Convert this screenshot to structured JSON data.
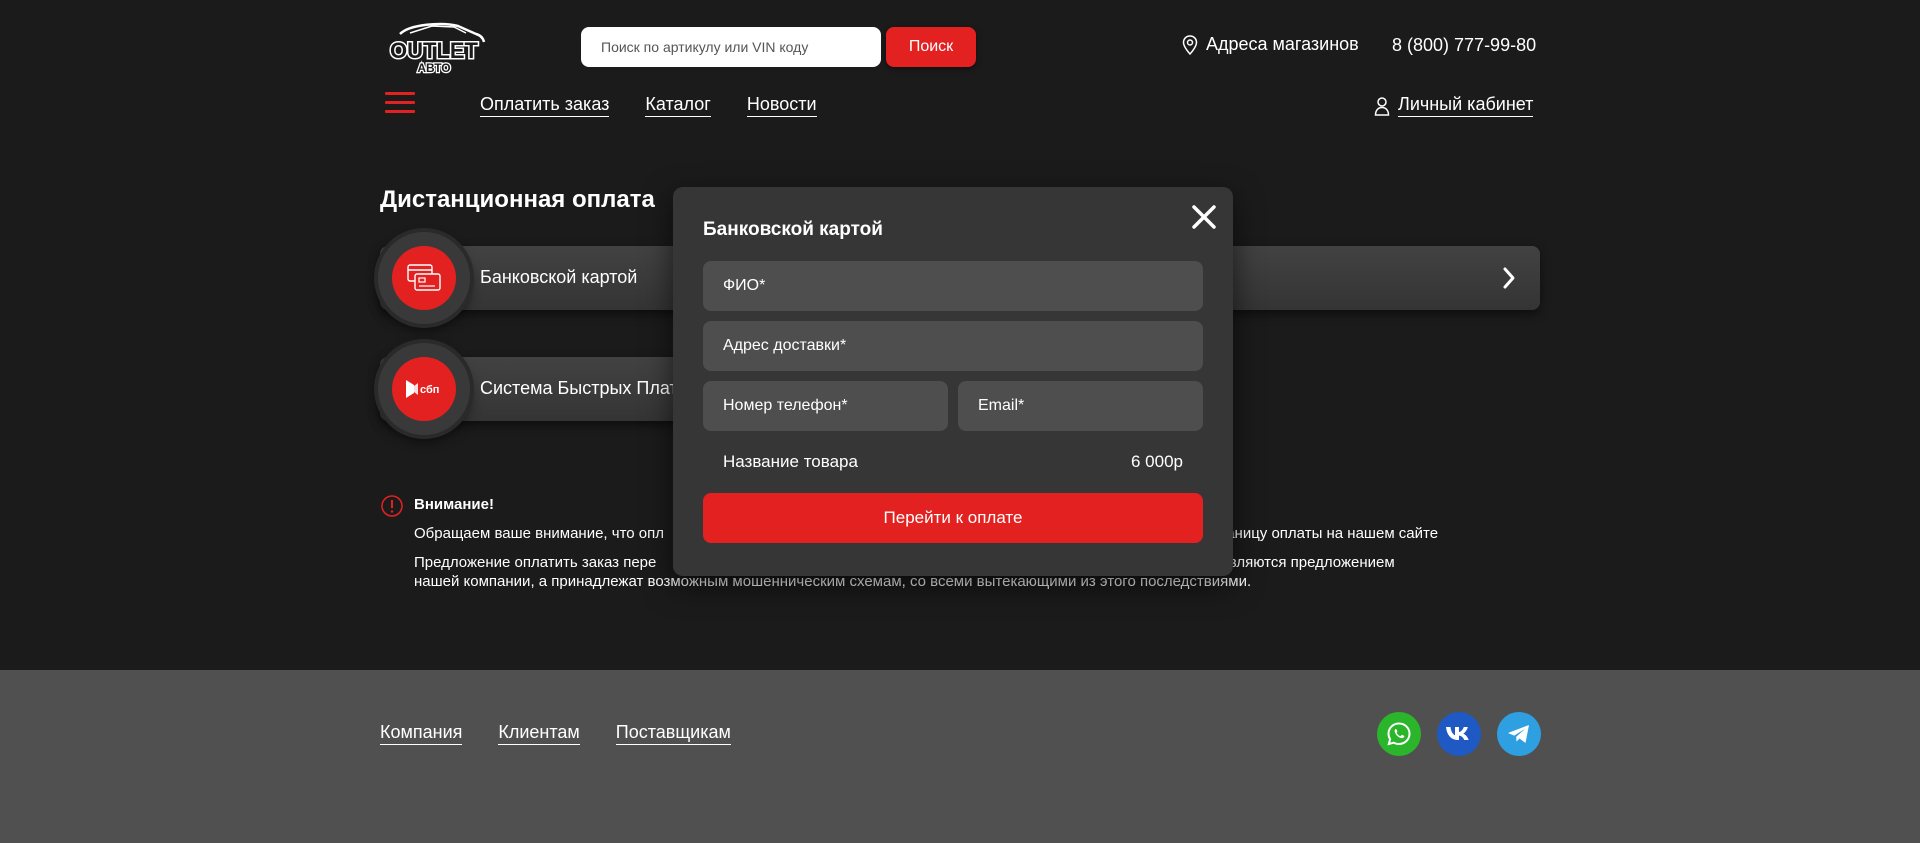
{
  "header": {
    "logo_text_top": "OUTLET",
    "logo_text_bottom": "АВТО",
    "search": {
      "placeholder": "Поиск по артикулу или VIN коду",
      "button": "Поиск"
    },
    "stores_label": "Адреса магазинов",
    "phone": "8 (800) 777-99-80",
    "nav": [
      "Оплатить заказ",
      "Каталог",
      "Новости"
    ],
    "cabinet_label": "Личный кабинет"
  },
  "main": {
    "title": "Дистанционная оплата",
    "methods": [
      {
        "label": "Банковской картой",
        "icon": "bank-card-icon"
      },
      {
        "label": "Система Быстрых Плат",
        "icon": "sbp-icon",
        "icon_text": "сбп"
      }
    ],
    "notice": {
      "title": "Внимание!",
      "p1": "Обращаем ваше внимание, что опл                                                                                                                       через страницу оплаты на нашем сайте",
      "p2_line1": "Предложение оплатить заказ пере                                                                                                                     шелька не являются предложением",
      "p2_line2": "нашей компании, а принадлежат возможным мошенническим схемам, со всеми вытекающими из этого последствиями."
    }
  },
  "modal": {
    "title": "Банковской картой",
    "fields": {
      "name": "ФИО*",
      "address": "Адрес доставки*",
      "phone": "Номер телефон*",
      "email": "Email*"
    },
    "product_name": "Название товара",
    "product_price": "6 000р",
    "pay_button": "Перейти к оплате"
  },
  "footer": {
    "nav": [
      "Компания",
      "Клиентам",
      "Поставщикам"
    ],
    "socials": [
      {
        "name": "whatsapp",
        "color": "#2bb52b"
      },
      {
        "name": "vk",
        "color": "#1e59c4"
      },
      {
        "name": "telegram",
        "color": "#2ea0e2"
      }
    ]
  },
  "colors": {
    "accent": "#e42121",
    "background": "#1c1b1c",
    "footer": "#515051",
    "modal": "#373637"
  }
}
